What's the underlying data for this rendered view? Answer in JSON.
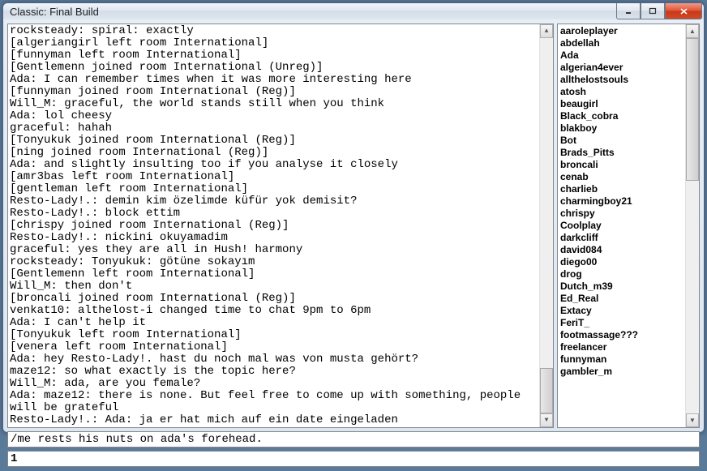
{
  "window": {
    "title": "Classic: Final Build"
  },
  "chat": {
    "lines": [
      "rocksteady: spiral: exactly",
      "[algeriangirl left room International]",
      "[funnyman left room International]",
      "[Gentlemenn joined room International (Unreg)]",
      "Ada: I can remember times when it was more interesting here",
      "[funnyman joined room International (Reg)]",
      "Will_M: graceful, the world stands still when you think",
      "Ada: lol cheesy",
      "graceful: hahah",
      "[Tonyukuk joined room International (Reg)]",
      "[ning joined room International (Reg)]",
      "Ada: and slightly insulting too if you analyse it closely",
      "[amr3bas left room International]",
      "[gentleman left room International]",
      "Resto-Lady!.: demin kim özelimde küfür yok demisit?",
      "Resto-Lady!.: block ettim",
      "[chrispy joined room International (Reg)]",
      "Resto-Lady!.: nickini okuyamadim",
      "graceful: yes they are all in Hush! harmony",
      "rocksteady: Tonyukuk: götüne sokayım",
      "[Gentlemenn left room International]",
      "Will_M: then don't",
      "[broncali joined room International (Reg)]",
      "venkat10: althelost-i changed time to chat 9pm to 6pm",
      "Ada: I can't help it",
      "[Tonyukuk left room International]",
      "[venera left room International]",
      "Ada: hey Resto-Lady!. hast du noch mal was von musta gehört?",
      "maze12: so what exactly is the topic here?",
      "Will_M: ada, are you female?",
      "Ada: maze12: there is none. But feel free to come up with something, people will be grateful",
      "Resto-Lady!.: Ada: ja er hat mich auf ein date eingeladen"
    ]
  },
  "users": [
    "aaroleplayer",
    "abdellah",
    "Ada",
    "algerian4ever",
    "allthelostsouls",
    "atosh",
    "beaugirl",
    "Black_cobra",
    "blakboy",
    "Bot",
    "Brads_Pitts",
    "broncali",
    "cenab",
    "charlieb",
    "charmingboy21",
    "chrispy",
    "Coolplay",
    "darkcliff",
    "david084",
    "diego00",
    "drog",
    "Dutch_m39",
    "Ed_Real",
    "Extacy",
    "FeriT_",
    "footmassage???",
    "freelancer",
    "funnyman",
    "gambler_m"
  ],
  "input": {
    "value": "/me rests his nuts on ada's forehead."
  },
  "status": {
    "text": "1"
  }
}
